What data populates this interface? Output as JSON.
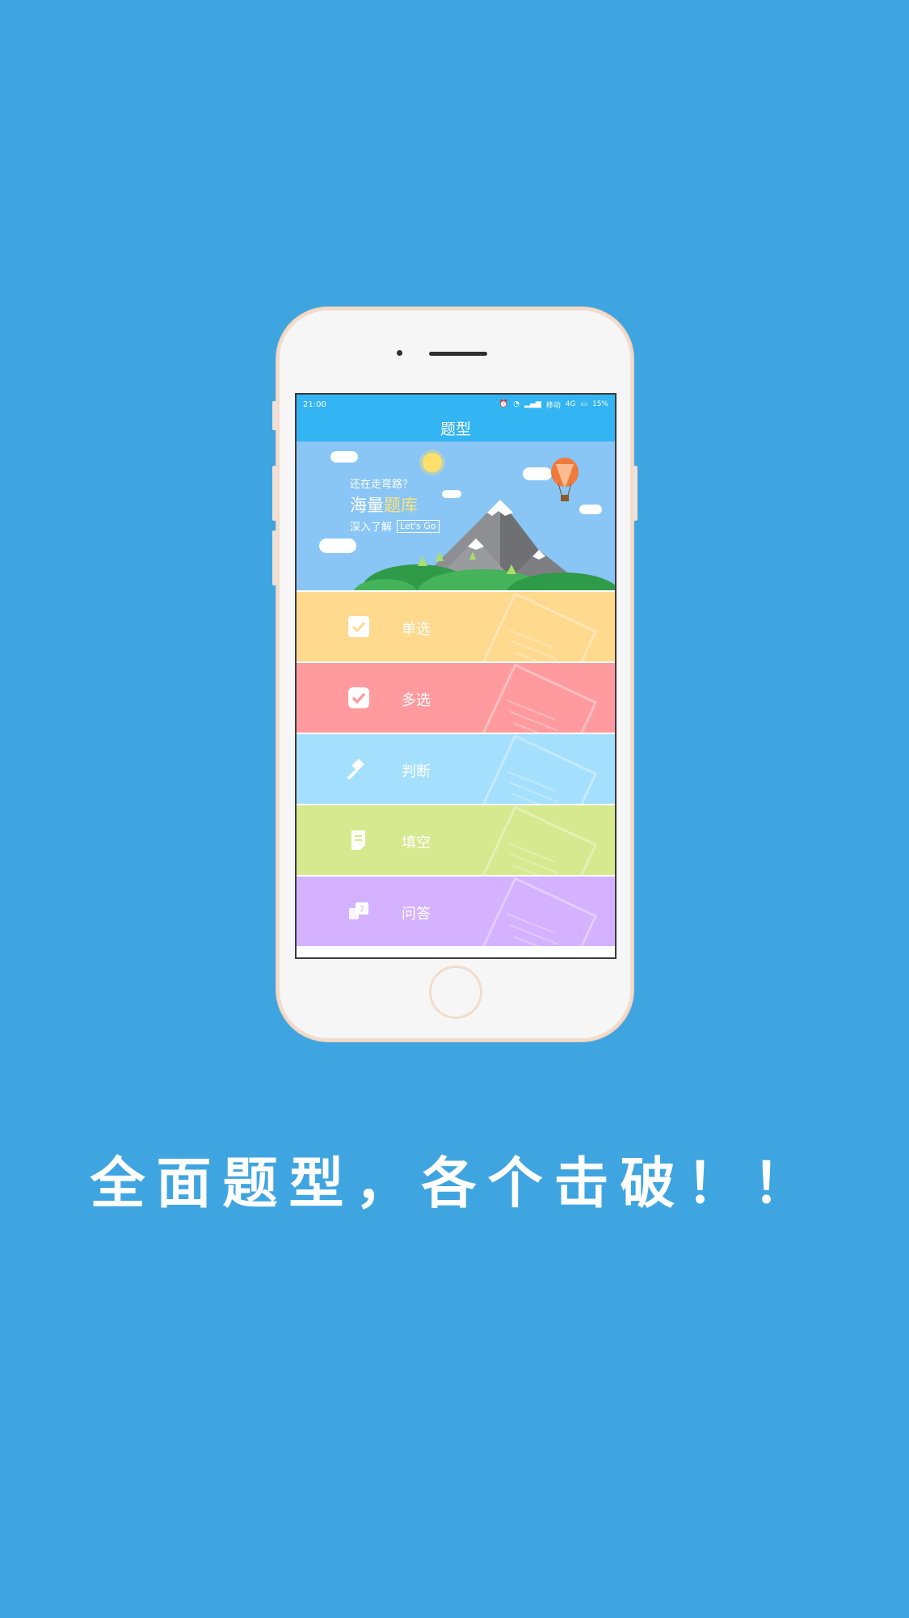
{
  "status": {
    "time": "21:00",
    "carrier": "移动",
    "network": "4G",
    "battery": "15%"
  },
  "title": "题型",
  "banner": {
    "line1": "还在走弯路？",
    "line2_a": "海量",
    "line2_b": "题库",
    "line3": "深入了解",
    "cta": "Let's Go"
  },
  "items": [
    {
      "label": "单选",
      "icon": "checkbox-icon",
      "color": "#ffd98e"
    },
    {
      "label": "多选",
      "icon": "checkbox-checked-icon",
      "color": "#ff9b9f"
    },
    {
      "label": "判断",
      "icon": "gavel-icon",
      "color": "#a5dffe"
    },
    {
      "label": "填空",
      "icon": "document-icon",
      "color": "#d6e98e"
    },
    {
      "label": "问答",
      "icon": "question-chat-icon",
      "color": "#d4b2ff"
    }
  ],
  "slogan": "全面题型，各个击破！！"
}
